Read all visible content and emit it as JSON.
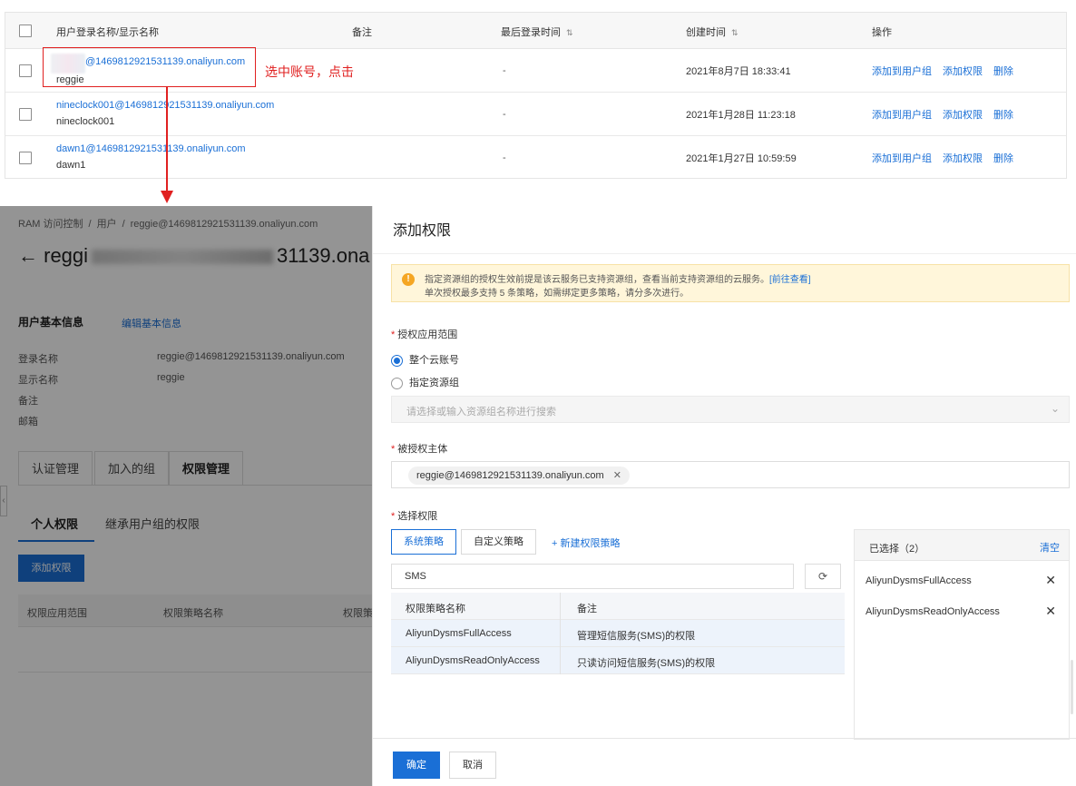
{
  "users_table": {
    "headers": {
      "name": "用户登录名称/显示名称",
      "note": "备注",
      "last_login": "最后登录时间",
      "created": "创建时间",
      "actions": "操作"
    },
    "rows": [
      {
        "login": "@1469812921531139.onaliyun.com",
        "display": "reggie",
        "last_login": "-",
        "created": "2021年8月7日 18:33:41"
      },
      {
        "login": "nineclock001@1469812921531139.onaliyun.com",
        "display": "nineclock001",
        "last_login": "-",
        "created": "2021年1月28日 11:23:18"
      },
      {
        "login": "dawn1@1469812921531139.onaliyun.com",
        "display": "dawn1",
        "last_login": "-",
        "created": "2021年1月27日 10:59:59"
      }
    ],
    "action_labels": {
      "add_group": "添加到用户组",
      "add_perm": "添加权限",
      "delete": "删除"
    }
  },
  "annotation": {
    "note": "选中账号，点击",
    "color": "#e02020"
  },
  "detail_page": {
    "breadcrumb": [
      "RAM 访问控制",
      "/",
      "用户",
      "/",
      "reggie@1469812921531139.onaliyun.com"
    ],
    "title_prefix": "← reggi",
    "title_suffix": "31139.ona",
    "basic_info_title": "用户基本信息",
    "edit_link": "编辑基本信息",
    "fields": [
      {
        "label": "登录名称",
        "value": "reggie@1469812921531139.onaliyun.com"
      },
      {
        "label": "显示名称",
        "value": "reggie"
      },
      {
        "label": "备注",
        "value": ""
      },
      {
        "label": "邮箱",
        "value": ""
      }
    ],
    "tabs": [
      "认证管理",
      "加入的组",
      "权限管理"
    ],
    "subtabs": [
      "个人权限",
      "继承用户组的权限"
    ],
    "add_button": "添加权限",
    "table_headers": [
      "权限应用范围",
      "权限策略名称",
      "权限策"
    ]
  },
  "drawer": {
    "title": "添加权限",
    "notice_line1": "指定资源组的授权生效前提是该云服务已支持资源组，查看当前支持资源组的云服务。",
    "notice_link": "[前往查看]",
    "notice_line2": "单次授权最多支持 5 条策略，如需绑定更多策略，请分多次进行。",
    "scope_label": "授权应用范围",
    "scope_options": [
      "整个云账号",
      "指定资源组"
    ],
    "scope_selected": "整个云账号",
    "rg_placeholder": "请选择或输入资源组名称进行搜索",
    "principal_label": "被授权主体",
    "principal_value": "reggie@1469812921531139.onaliyun.com",
    "policy_label": "选择权限",
    "policy_tabs": [
      "系统策略",
      "自定义策略"
    ],
    "new_policy": "+ 新建权限策略",
    "search_value": "SMS",
    "policy_table_headers": [
      "权限策略名称",
      "备注"
    ],
    "policies": [
      {
        "name": "AliyunDysmsFullAccess",
        "note": "管理短信服务(SMS)的权限"
      },
      {
        "name": "AliyunDysmsReadOnlyAccess",
        "note": "只读访问短信服务(SMS)的权限"
      }
    ],
    "selected_title": "已选择（2）",
    "clear": "清空",
    "selected": [
      "AliyunDysmsFullAccess",
      "AliyunDysmsReadOnlyAccess"
    ],
    "ok": "确定",
    "cancel": "取消",
    "accent": "#1a6fd6"
  }
}
